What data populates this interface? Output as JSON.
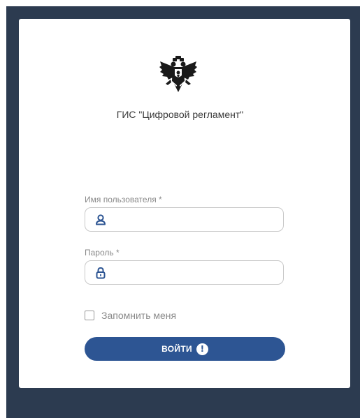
{
  "app": {
    "title": "ГИС \"Цифровой регламент\""
  },
  "form": {
    "username": {
      "label": "Имя пользователя *",
      "value": "",
      "placeholder": ""
    },
    "password": {
      "label": "Пароль *",
      "value": "",
      "placeholder": ""
    },
    "remember_label": "Запомнить меня",
    "remember_checked": false,
    "login_label": "ВОЙТИ",
    "warning_glyph": "!"
  },
  "icons": {
    "emblem": "double-headed-eagle-emblem",
    "username": "user-icon",
    "password": "lock-icon",
    "warning": "exclamation-icon"
  },
  "colors": {
    "background": "#2c3b50",
    "card": "#ffffff",
    "accent": "#2d5593",
    "label": "#8a8a8a",
    "border": "#c8c8c8"
  }
}
